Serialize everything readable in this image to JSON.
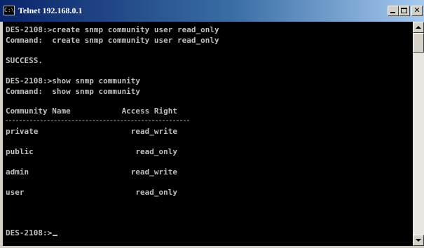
{
  "window": {
    "title": "Telnet 192.168.0.1",
    "icon": "console-icon",
    "icon_text": "C:\\"
  },
  "title_buttons": {
    "minimize_icon": "minimize-icon",
    "maximize_icon": "maximize-icon",
    "close_icon": "close-icon",
    "close_glyph": "✕"
  },
  "terminal": {
    "lines": [
      "DES-2108:>create snmp community user read_only",
      "Command:  create snmp community user read_only",
      "SUCCESS.",
      "DES-2108:>show snmp community",
      "Command:  show snmp community",
      "Community Name           Access Right",
      "private                    read_write",
      "public                      read_only",
      "admin                      read_write",
      "user                        read_only",
      "DES-2108:>"
    ]
  },
  "colors": {
    "terminal_bg": "#000000",
    "terminal_fg": "#c0c0c0",
    "title_gradient_start": "#0a246a",
    "title_gradient_end": "#a6caf0"
  }
}
